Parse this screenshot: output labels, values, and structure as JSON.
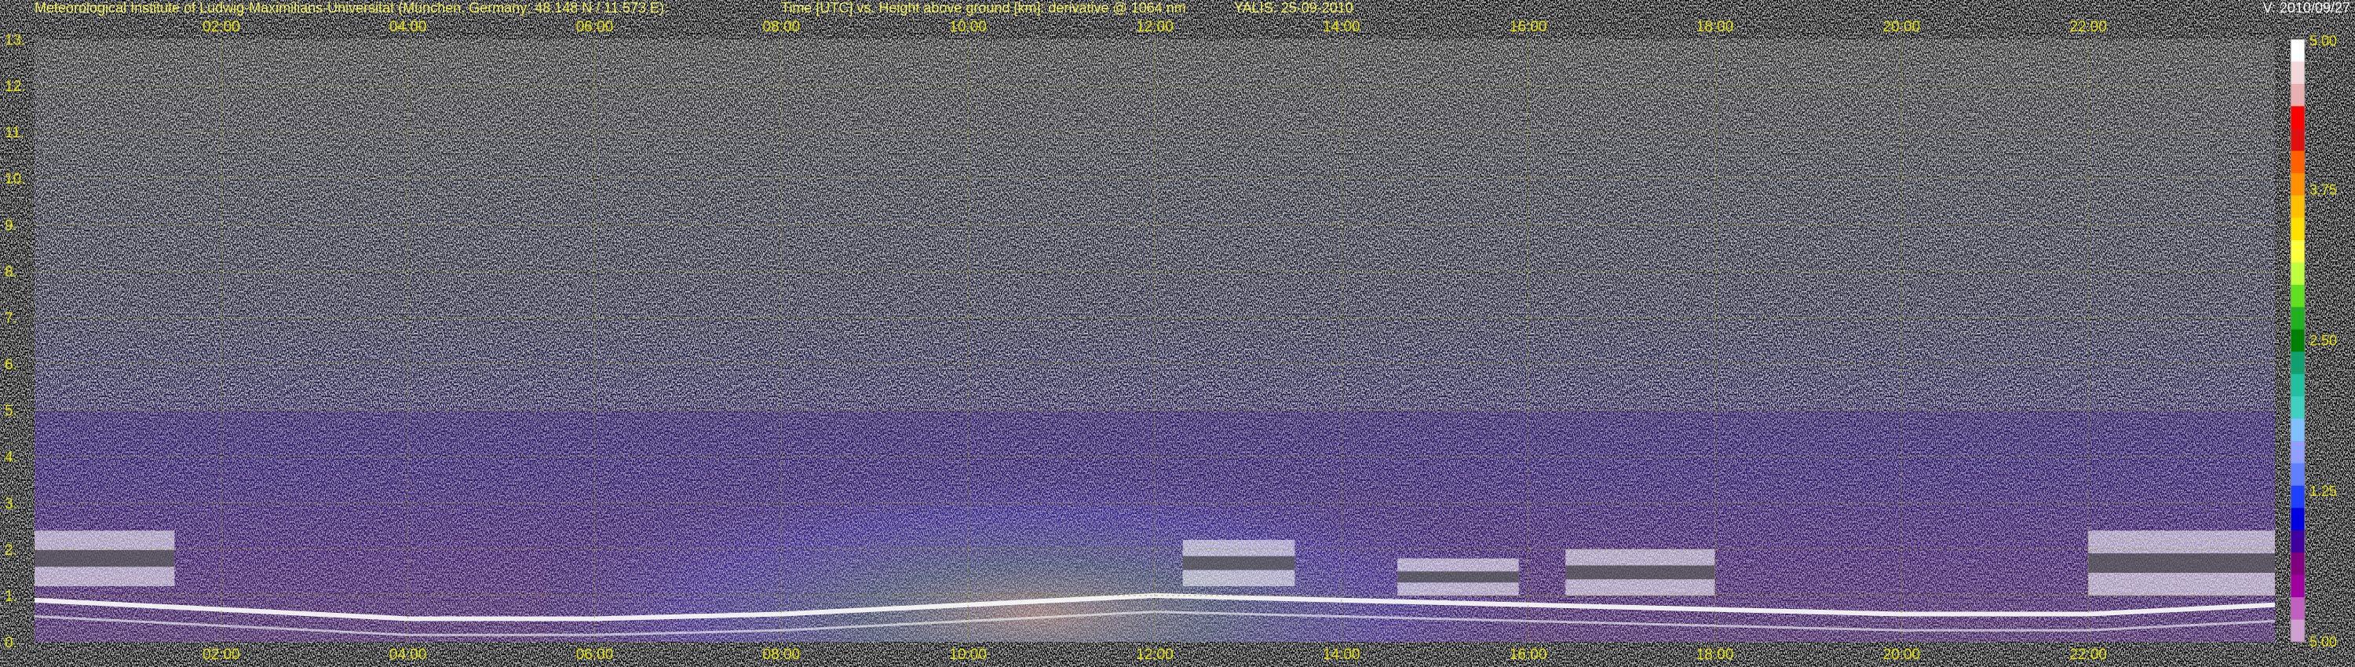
{
  "header": {
    "institute": "Meteorological Institute of Ludwig-Maximilians-Universität (München, Germany; 48.148 N / 11.573 E):",
    "axes_desc": "Time [UTC] vs. Height above ground [km]: derivative @ 1064 nm",
    "instrument": "YALIS: 25-09-2010",
    "version": "V: 2010/09/27"
  },
  "chart_data": {
    "type": "heatmap",
    "title": "Time [UTC] vs. Height above ground [km]: derivative @ 1064 nm",
    "x_ticks": [
      "02:00",
      "04:00",
      "06:00",
      "08:00",
      "10:00",
      "12:00",
      "14:00",
      "16:00",
      "18:00",
      "20:00",
      "22:00"
    ],
    "x_tick_hours": [
      2,
      4,
      6,
      8,
      10,
      12,
      14,
      16,
      18,
      20,
      22
    ],
    "xlim_hours": [
      0,
      24
    ],
    "y_ticks": [
      "0.",
      "1.",
      "2.",
      "3.",
      "4.",
      "5.",
      "6.",
      "7.",
      "8.",
      "9.",
      "10.",
      "11.",
      "12.",
      "13."
    ],
    "ylim_km": [
      0,
      13
    ],
    "grid": true,
    "colorbar": {
      "ticks": [
        "5.00",
        "3.75",
        "2.50",
        "1.25",
        "5.00"
      ],
      "tick_fractions": [
        1.0,
        0.75,
        0.5,
        0.25,
        0.0
      ],
      "colors": [
        "#ffffff",
        "#f2d8d8",
        "#e8b0b0",
        "#ff0000",
        "#e01010",
        "#ff6000",
        "#ff9000",
        "#ffc000",
        "#ffe000",
        "#ffff40",
        "#c0ff40",
        "#60e020",
        "#20b020",
        "#008000",
        "#10a070",
        "#20c0a0",
        "#40d0c0",
        "#80c0ff",
        "#90a0ff",
        "#6080ff",
        "#2040ff",
        "#0000e0",
        "#4000a0",
        "#800080",
        "#a000a0",
        "#c060c0",
        "#d0a0d0"
      ]
    },
    "cloud_layers": [
      {
        "start_h": 0.0,
        "end_h": 1.5,
        "base_km": 1.2,
        "top_km": 2.4
      },
      {
        "start_h": 12.3,
        "end_h": 13.5,
        "base_km": 1.2,
        "top_km": 2.2
      },
      {
        "start_h": 14.6,
        "end_h": 15.9,
        "base_km": 1.0,
        "top_km": 1.8
      },
      {
        "start_h": 16.4,
        "end_h": 18.0,
        "base_km": 1.0,
        "top_km": 2.0
      },
      {
        "start_h": 22.0,
        "end_h": 24.0,
        "base_km": 1.0,
        "top_km": 2.4
      }
    ],
    "boundary_layer": [
      {
        "h": 0,
        "km": 0.9
      },
      {
        "h": 2,
        "km": 0.7
      },
      {
        "h": 4,
        "km": 0.5
      },
      {
        "h": 6,
        "km": 0.5
      },
      {
        "h": 8,
        "km": 0.6
      },
      {
        "h": 10,
        "km": 0.8
      },
      {
        "h": 12,
        "km": 1.0
      },
      {
        "h": 14,
        "km": 0.9
      },
      {
        "h": 16,
        "km": 0.8
      },
      {
        "h": 18,
        "km": 0.7
      },
      {
        "h": 20,
        "km": 0.6
      },
      {
        "h": 22,
        "km": 0.6
      },
      {
        "h": 24,
        "km": 0.8
      }
    ]
  }
}
